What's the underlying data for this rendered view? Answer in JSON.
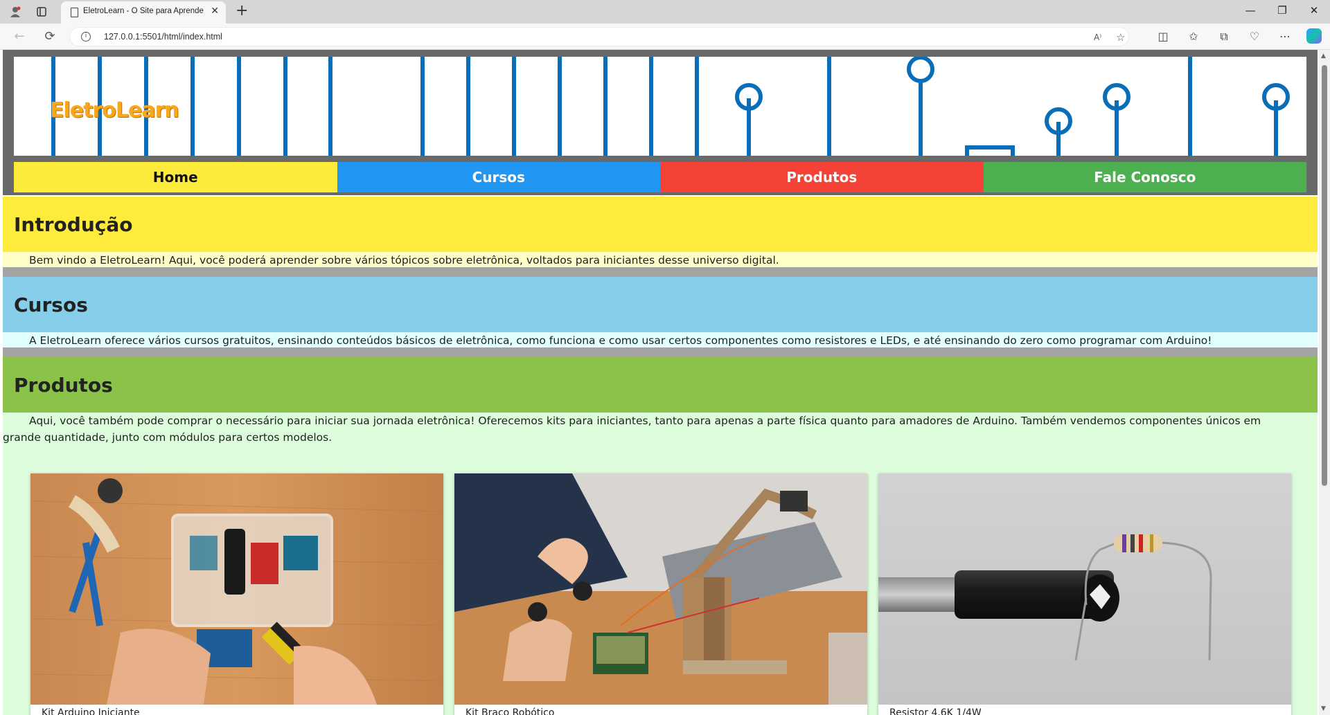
{
  "browser": {
    "tab_title": "EletroLearn - O Site para Aprende",
    "url": "127.0.0.1:5501/html/index.html",
    "new_tab": "+",
    "win_minimize": "—",
    "win_restore": "❐",
    "win_close": "✕"
  },
  "site": {
    "logo": "EletroLearn",
    "menu": [
      "Home",
      "Cursos",
      "Produtos",
      "Fale Conosco"
    ]
  },
  "sections": {
    "intro": {
      "title": "Introdução",
      "body": "Bem vindo a EletroLearn! Aqui, você poderá aprender sobre vários tópicos sobre eletrônica, voltados para iniciantes desse universo digital."
    },
    "cursos": {
      "title": "Cursos",
      "body": "A EletroLearn oferece vários cursos gratuitos, ensinando conteúdos básicos de eletrônica, como funciona e como usar certos componentes como resistores e LEDs, e até ensinando do zero como programar com Arduino!"
    },
    "produtos": {
      "title": "Produtos",
      "body": "Aqui, você também pode comprar o necessário para iniciar sua jornada eletrônica! Oferecemos kits para iniciantes, tanto para apenas a parte física quanto para amadores de Arduino. Também vendemos componentes únicos em grande quantidade, junto com módulos para certos modelos."
    }
  },
  "products": [
    {
      "label": "Kit Arduino Iniciante"
    },
    {
      "label": "Kit Braço Robótico"
    },
    {
      "label": "Resistor 4.6K 1/4W"
    }
  ],
  "colors": {
    "home": "#fdeb3b",
    "cursos": "#2196f3",
    "produtos": "#f44336",
    "fale": "#4caf50",
    "circuit_lines": "#0a6db8"
  }
}
